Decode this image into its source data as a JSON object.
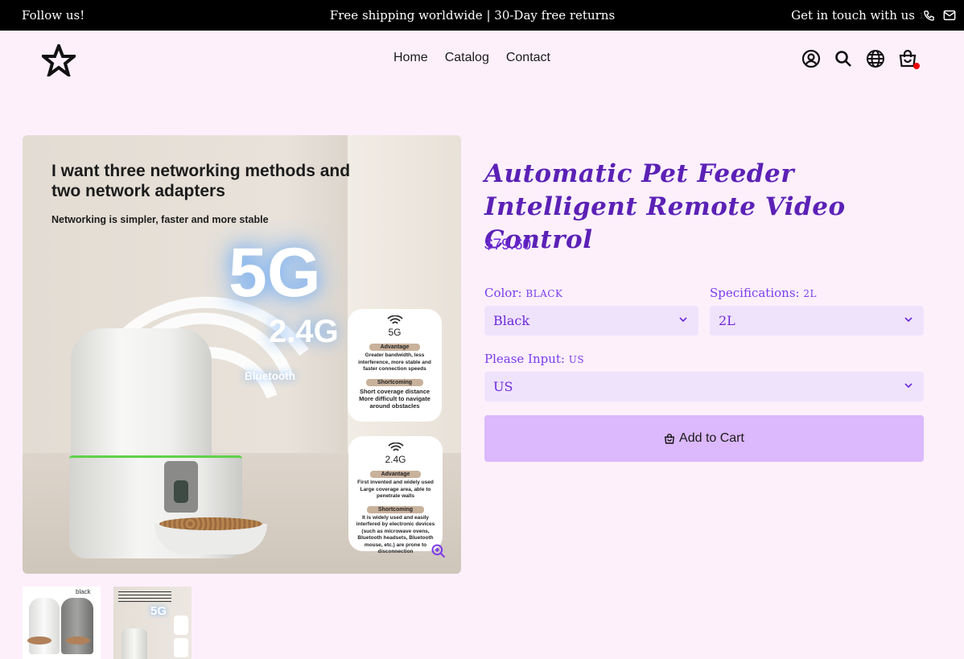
{
  "announcement": {
    "left": "Follow us!",
    "center": "Free shipping worldwide | 30-Day free returns",
    "right": "Get in touch with us"
  },
  "header": {
    "logo_icon": "star-icon",
    "nav": [
      "Home",
      "Catalog",
      "Contact"
    ],
    "icons": [
      "account-icon",
      "search-icon",
      "globe-icon",
      "cart-icon"
    ],
    "cart_count": "1"
  },
  "gallery": {
    "main_image": {
      "headline": "I want three networking methods and two network adapters",
      "subhead": "Networking is simpler, faster and more stable",
      "big_5g": "5G",
      "big_24g": "2.4G",
      "bluetooth": "Bluetooth",
      "card_5g": {
        "title": "5G",
        "advantage_label": "Advantage",
        "advantage_text": "Greater bandwidth, less interference, more stable and faster connection speeds",
        "shortcoming_label": "Shortcoming",
        "shortcoming_text": "Short coverage distance More difficult to navigate around obstacles"
      },
      "card_24g": {
        "title": "2.4G",
        "advantage_label": "Advantage",
        "advantage_text": "First invented and widely used Large coverage area, able to penetrate walls",
        "shortcoming_label": "Shortcoming",
        "shortcoming_text": "It is widely used and easily interfered by electronic devices (such as microwave ovens, Bluetooth headsets, Bluetooth mouse, etc.) are prone to disconnection"
      }
    },
    "thumbnails": [
      {
        "label": "black"
      },
      {
        "label": "5G"
      }
    ]
  },
  "product": {
    "title": "Automatic Pet Feeder Intelligent Remote Video Control",
    "price": "$79.60",
    "color": {
      "label": "Color:",
      "value": "BLACK",
      "selected": "Black"
    },
    "spec": {
      "label": "Specifications:",
      "value": "2L",
      "selected": "2L"
    },
    "input": {
      "label": "Please Input:",
      "value": "US",
      "selected": "US"
    },
    "add_to_cart": "Add to Cart"
  },
  "colors": {
    "accent": "#6d28d9",
    "button_bg": "#dcb8fc",
    "select_bg": "#efe3fc",
    "page_bg": "#fdf0fb"
  }
}
